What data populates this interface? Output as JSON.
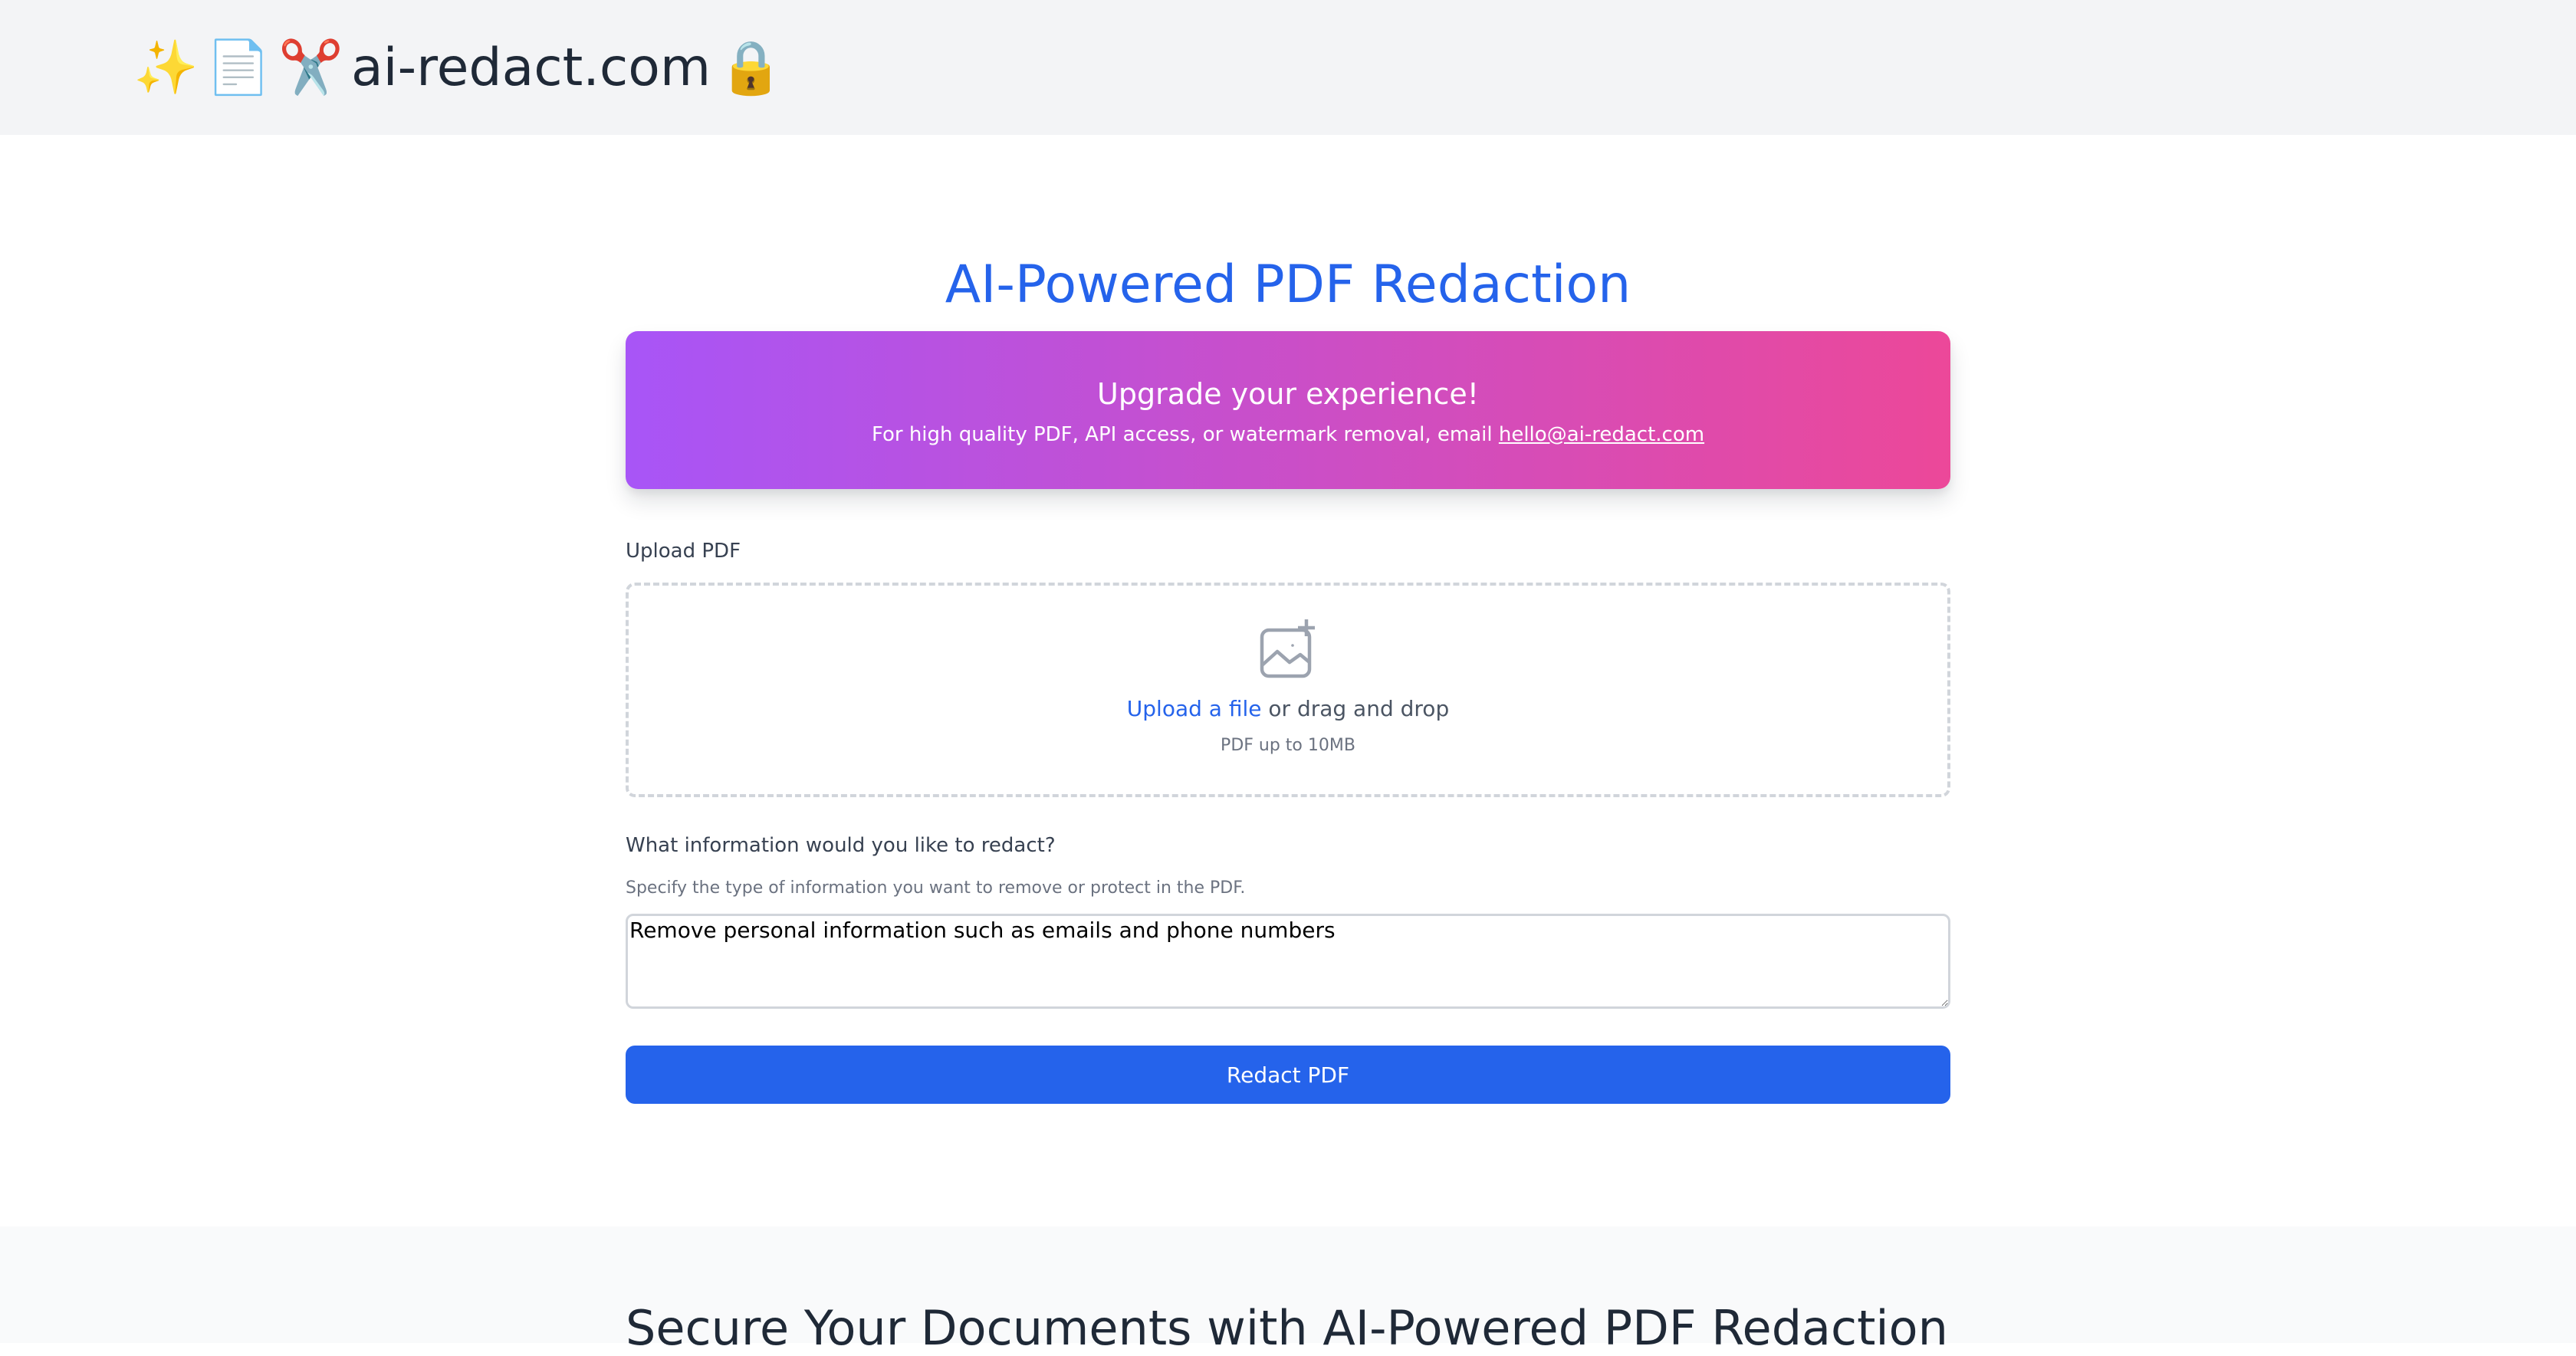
{
  "header": {
    "brand_emojis": [
      "✨",
      "📄",
      "✂️"
    ],
    "brand_name": "ai-redact.com",
    "brand_lock": "🔒"
  },
  "main": {
    "title": "AI-Powered PDF Redaction",
    "promo": {
      "title": "Upgrade your experience!",
      "text": "For high quality PDF, API access, or watermark removal, email",
      "email": "hello@ai-redact.com"
    },
    "upload": {
      "label": "Upload PDF",
      "link_text": "Upload a file",
      "suffix_text": " or drag and drop",
      "hint": "PDF up to 10MB",
      "icon": "image-add-icon"
    },
    "redact": {
      "label": "What information would you like to redact?",
      "helper": "Specify the type of information you want to remove or protect in the PDF.",
      "value": "Remove personal information such as emails and phone numbers"
    },
    "submit_label": "Redact PDF"
  },
  "section": {
    "title": "Secure Your Documents with AI-Powered PDF Redaction"
  },
  "colors": {
    "accent": "#2563eb",
    "gradient_start": "#a855f7",
    "gradient_end": "#ec4899",
    "header_bg": "#f3f4f6"
  }
}
